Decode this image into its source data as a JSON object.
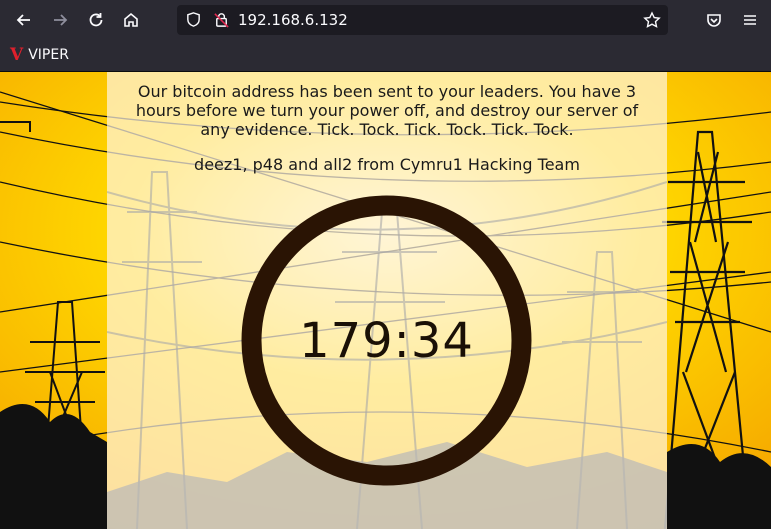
{
  "browser": {
    "url": "192.168.6.132",
    "bookmarks": [
      {
        "icon": "V",
        "label": "VIPER"
      }
    ]
  },
  "page": {
    "message": "Our bitcoin address has been sent to your leaders. You have 3 hours before we turn your power off, and destroy our server of any evidence. Tick. Tock. Tick. Tock. Tick. Tock.",
    "signature": "deez1, p48 and all2 from Cymru1 Hacking Team",
    "countdown": "179:34"
  },
  "colors": {
    "accent": "#f7c600",
    "ring": "#2a1404",
    "panel": "#fff4de"
  }
}
